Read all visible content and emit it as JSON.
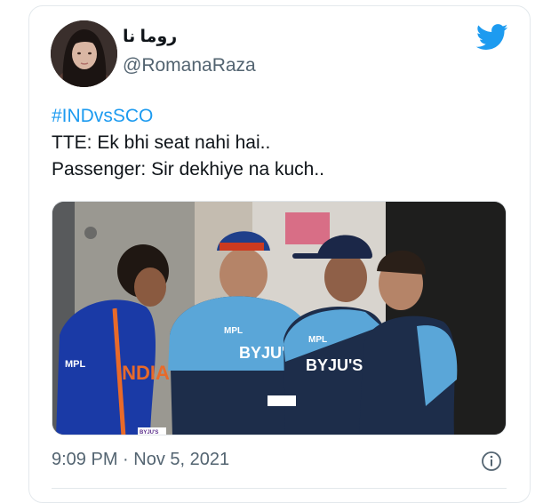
{
  "author": {
    "display_name": "روما نا",
    "handle": "@RomanaRaza"
  },
  "tweet": {
    "hashtag": "#INDvsSCO",
    "lines": [
      "TTE: Ek bhi seat nahi hai..",
      "Passenger: Sir dekhiye na kuch.."
    ]
  },
  "media": {
    "jersey_text": [
      "MPL",
      "BYJU'S",
      "MPL",
      "BYJU'S",
      "MPL",
      "INDIA"
    ],
    "watermark": "BYJU'S"
  },
  "meta": {
    "timestamp": "9:09 PM · Nov 5, 2021"
  },
  "icons": {
    "brand": "twitter-bird-icon",
    "info": "info-icon"
  },
  "colors": {
    "link": "#1d9bf0",
    "text": "#0f1419",
    "secondary": "#536471"
  }
}
